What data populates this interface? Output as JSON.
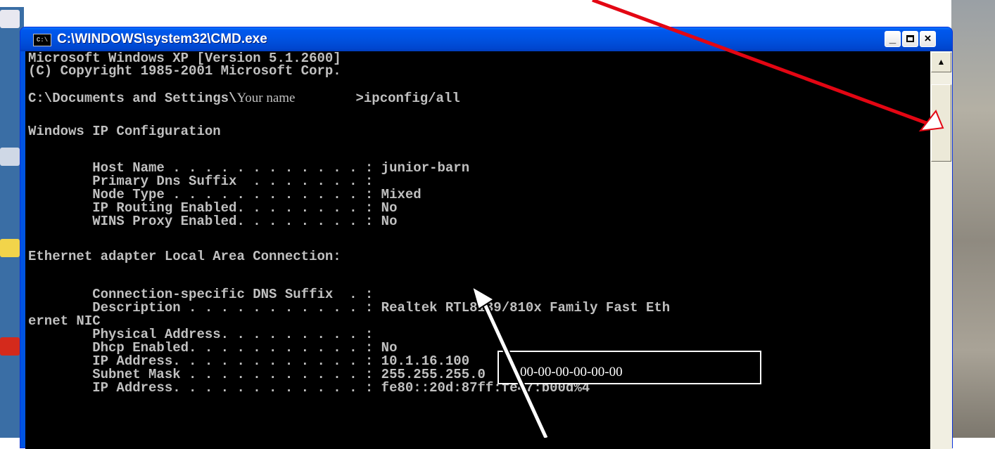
{
  "window": {
    "icon_label": "C:\\",
    "title": "C:\\WINDOWS\\system32\\CMD.exe",
    "minimize_label": "_",
    "close_label": "×"
  },
  "console": {
    "lines": [
      "Microsoft Windows XP [Version 5.1.2600]",
      "(C) Copyright 1985-2001 Microsoft Corp.",
      "C:\\Documents and Settings\\",
      "Your name",
      ">ipconfig/all",
      "Windows IP Configuration",
      "        Host Name . . . . . . . . . . . . : junior-barn",
      "        Primary Dns Suffix  . . . . . . . :",
      "        Node Type . . . . . . . . . . . . : Mixed",
      "        IP Routing Enabled. . . . . . . . : No",
      "        WINS Proxy Enabled. . . . . . . . : No",
      "Ethernet adapter Local Area Connection:",
      "        Connection-specific DNS Suffix  . :",
      "        Description . . . . . . . . . . . : Realtek RTL8139/810x Family Fast Eth",
      "ernet NIC",
      "        Physical Address. . . . . . . . . :",
      "        Dhcp Enabled. . . . . . . . . . . : No",
      "        IP Address. . . . . . . . . . . . : 10.1.16.100",
      "        Subnet Mask . . . . . . . . . . . : 255.255.255.0",
      "        IP Address. . . . . . . . . . . . : fe80::20d:87ff:fe47:b00d%4"
    ],
    "mac_placeholder": "00-00-00-00-00-00"
  },
  "colors": {
    "console_bg": "#000000",
    "console_text": "#c0c0c0",
    "titlebar": "#0054e3",
    "arrow_red": "#e30613",
    "arrow_white": "#ffffff"
  },
  "icons": {
    "window_icon": "cmd-icon",
    "scroll_up": "scroll-up-arrow-icon"
  }
}
